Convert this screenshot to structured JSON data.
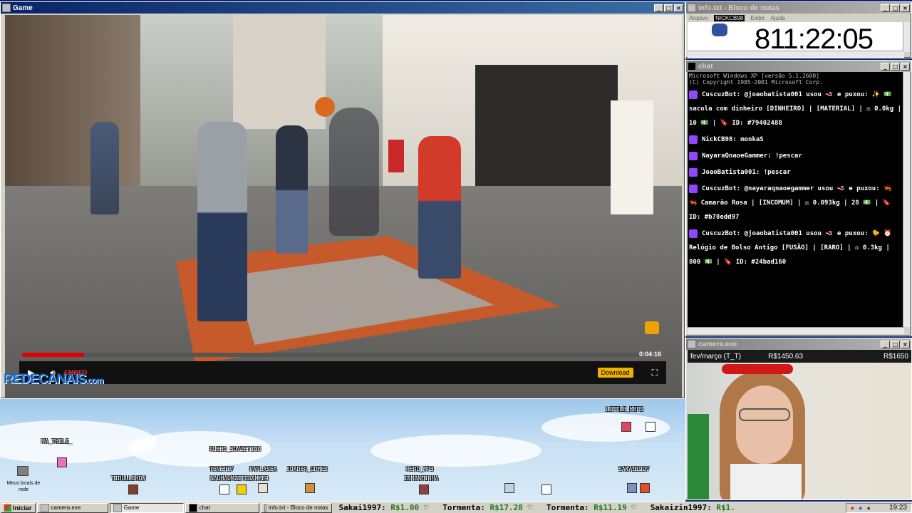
{
  "game_window": {
    "title": "Game",
    "player": {
      "progress_fraction": 0.1,
      "time": "0:04:16",
      "embed_label": "EMBED",
      "download_label": "Download"
    },
    "site_logo": "REDECANAIS",
    "site_logo_suffix": ".com"
  },
  "stream_overlay": {
    "usernames": [
      {
        "name": "MA_THELS_"
      },
      {
        "name": "TIDULLSHOW"
      },
      {
        "name": "RUBBO_SOVIETICO"
      },
      {
        "name": "TENET17"
      },
      {
        "name": "PAPLASEA"
      },
      {
        "name": "JOADER_GOMES"
      },
      {
        "name": "NAUMAUMZITOGAMMER"
      },
      {
        "name": "HERO_MP3"
      },
      {
        "name": "ISMANTINHA"
      },
      {
        "name": "LITTLE_MEPS"
      },
      {
        "name": "SAKAI1997"
      }
    ],
    "desktop_icon_label": "Meus locais de rede"
  },
  "info_window": {
    "title": "info.txt - Bloco de notas",
    "menu": [
      "Arquivo",
      "NICKCB98",
      "Exibir",
      "Ajuda"
    ],
    "timer": "811:22:05"
  },
  "chat_window": {
    "title": "chat",
    "header_lines": [
      "Microsoft Windows XP [versão 5.1.2600]",
      "(C) Copyright 1985-2001 Microsoft Corp."
    ],
    "messages": [
      {
        "nick": "CuscuzBot:",
        "text": "@joaobatista001 usou 🪱 e puxou: ✨ 💵 sacola com dinheiro [DINHEIRO] | [MATERIAL] | ⚖ 0.0kg | 10 💵 | 🔖 ID: #79402488"
      },
      {
        "nick": "NickCB98:",
        "text": "monkaS"
      },
      {
        "nick": "NayaraQnaoeGammer:",
        "text": "!pescar"
      },
      {
        "nick": "JoaoBatista001:",
        "text": "!pescar"
      },
      {
        "nick": "CuscuzBot:",
        "text": "@nayaraqnaoegammer usou 🪱 e puxou: 🦐 🦐 Camarão Rosa | [INCOMUM] | ⚖ 0.093kg | 28 💵 | 🔖 ID: #b78edd97"
      },
      {
        "nick": "CuscuzBot:",
        "text": "@joaobatista001 usou 🪱 e puxou: 🐤 ⏰ Relógio de Bolso Antigo [FUSÃO] | [RARO] | ⚖ 0.3kg | 800 💵 | 🔖 ID: #24bad160"
      }
    ]
  },
  "camera_window": {
    "title": "camera.exe",
    "month_label": "fev/março (T_T)",
    "amount_current": "R$1450.63",
    "amount_goal": "R$1650"
  },
  "taskbar": {
    "start_label": "Iniciar",
    "tasks": [
      "camera.exe",
      "Game",
      "chat",
      "info.txt - Bloco de notas"
    ],
    "ticker": [
      {
        "name": "Sakai1997:",
        "value": "R$1.00"
      },
      {
        "name": "Tormenta:",
        "value": "R$17.28"
      },
      {
        "name": "Tormenta:",
        "value": "R$11.19"
      },
      {
        "name": "Sakaizin1997:",
        "value": "R$1."
      }
    ],
    "clock": "19:23"
  },
  "colors": {
    "titlebar_active": "#0a246a",
    "chat_nick": "#ffffff",
    "progress": "#e00000",
    "accent_purple": "#9146ff"
  }
}
